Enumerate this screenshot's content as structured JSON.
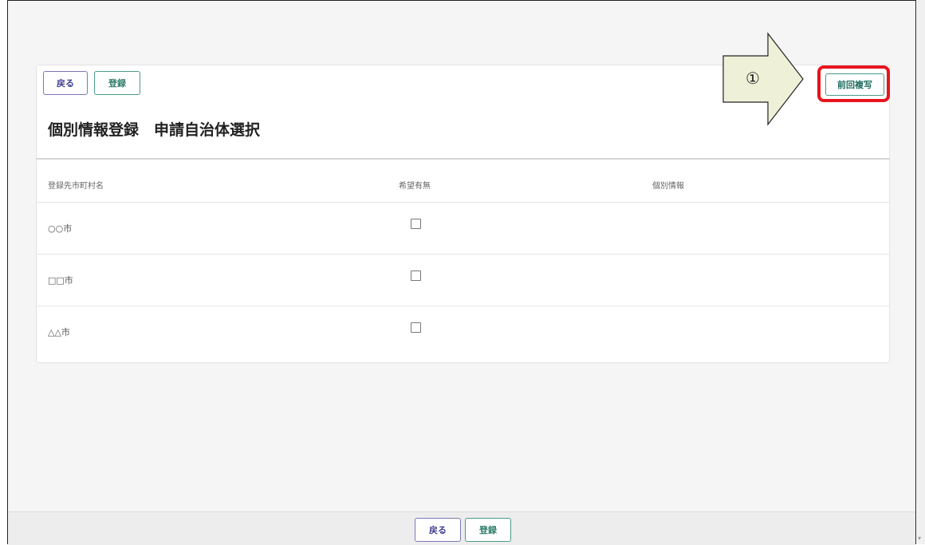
{
  "top_actions": {
    "back_label": "戻る",
    "register_label": "登録"
  },
  "page_title": "個別情報登録　申請自治体選択",
  "copy_button": {
    "label": "前回複写"
  },
  "annotation": {
    "marker": "①",
    "highlight_color": "#e8141e",
    "arrow_fill": "#eef0d8"
  },
  "table": {
    "headers": [
      "登録先市町村名",
      "希望有無",
      "個別情報"
    ],
    "rows": [
      {
        "name": "○○市",
        "checked": false
      },
      {
        "name": "□□市",
        "checked": false
      },
      {
        "name": "△△市",
        "checked": false
      }
    ]
  },
  "footer_actions": {
    "back_label": "戻る",
    "register_label": "登録"
  },
  "colors": {
    "back_border": "#7a78b8",
    "register_border": "#4b9b88"
  }
}
